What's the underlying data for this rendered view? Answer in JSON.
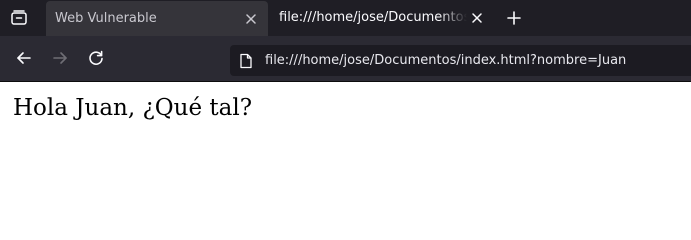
{
  "tabs": [
    {
      "title": "Web Vulnerable",
      "active": false
    },
    {
      "title": "file:///home/jose/Documentos/index.html?nombre=Juan",
      "active": true
    }
  ],
  "toolbar": {
    "url": "file:///home/jose/Documentos/index.html?nombre=Juan"
  },
  "page": {
    "heading": "Hola Juan, ¿Qué tal?"
  },
  "icons": {
    "tab_list": "tab-list-icon",
    "close": "close-icon",
    "new_tab": "plus-icon",
    "back": "back-arrow-icon",
    "forward": "forward-arrow-icon",
    "reload": "reload-icon",
    "page": "page-icon"
  },
  "colors": {
    "tabbar_bg": "#1f1e25",
    "inactive_tab_bg": "#35343a",
    "toolbar_bg": "#2b2a33",
    "urlbar_bg": "#1c1b22",
    "page_bg": "#ffffff"
  }
}
